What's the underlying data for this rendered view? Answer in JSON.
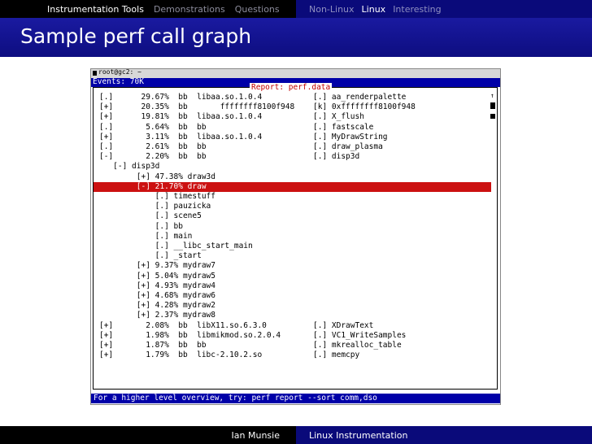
{
  "nav": {
    "left": [
      {
        "label": "Instrumentation Tools",
        "active": true
      },
      {
        "label": "Demonstrations",
        "active": false
      },
      {
        "label": "Questions",
        "active": false
      }
    ],
    "right": [
      {
        "label": "Non-Linux",
        "active": false
      },
      {
        "label": "Linux",
        "active": true
      },
      {
        "label": "Interesting",
        "active": false
      }
    ]
  },
  "slide": {
    "title": "Sample perf call graph"
  },
  "terminal": {
    "window_title": "root@gc2: ~",
    "events": "Events: 70K",
    "report_title": "Report: perf.data",
    "rows": [
      {
        "c1": "[.]      29.67%  bb  libaa.so.1.0.4",
        "c2": "[.] aa_renderpalette",
        "selected": false
      },
      {
        "c1": "[+]      20.35%  bb       ffffffff8100f948",
        "c2": "[k] 0xffffffff8100f948",
        "selected": false
      },
      {
        "c1": "[+]      19.81%  bb  libaa.so.1.0.4",
        "c2": "[.] X_flush",
        "selected": false
      },
      {
        "c1": "[.]       5.64%  bb  bb",
        "c2": "[.] fastscale",
        "selected": false
      },
      {
        "c1": "[+]       3.11%  bb  libaa.so.1.0.4",
        "c2": "[.] MyDrawString",
        "selected": false
      },
      {
        "c1": "[.]       2.61%  bb  bb",
        "c2": "[.] draw_plasma",
        "selected": false
      },
      {
        "c1": "[-]       2.20%  bb  bb",
        "c2": "[.] disp3d",
        "selected": false
      },
      {
        "c1": "   [-] disp3d",
        "c2": "",
        "selected": false
      },
      {
        "c1": "        [+] 47.38% draw3d",
        "c2": "",
        "selected": false
      },
      {
        "c1": "        [-] 21.70% draw",
        "c2": "",
        "selected": true
      },
      {
        "c1": "            [.] timestuff",
        "c2": "",
        "selected": false
      },
      {
        "c1": "            [.] pauzicka",
        "c2": "",
        "selected": false
      },
      {
        "c1": "            [.] scene5",
        "c2": "",
        "selected": false
      },
      {
        "c1": "            [.] bb",
        "c2": "",
        "selected": false
      },
      {
        "c1": "            [.] main",
        "c2": "",
        "selected": false
      },
      {
        "c1": "            [.] __libc_start_main",
        "c2": "",
        "selected": false
      },
      {
        "c1": "            [.] _start",
        "c2": "",
        "selected": false
      },
      {
        "c1": "        [+] 9.37% mydraw7",
        "c2": "",
        "selected": false
      },
      {
        "c1": "        [+] 5.04% mydraw5",
        "c2": "",
        "selected": false
      },
      {
        "c1": "        [+] 4.93% mydraw4",
        "c2": "",
        "selected": false
      },
      {
        "c1": "        [+] 4.68% mydraw6",
        "c2": "",
        "selected": false
      },
      {
        "c1": "        [+] 4.28% mydraw2",
        "c2": "",
        "selected": false
      },
      {
        "c1": "        [+] 2.37% mydraw8",
        "c2": "",
        "selected": false
      },
      {
        "c1": "[+]       2.08%  bb  libX11.so.6.3.0",
        "c2": "[.] XDrawText",
        "selected": false
      },
      {
        "c1": "[+]       1.98%  bb  libmikmod.so.2.0.4",
        "c2": "[.] VC1_WriteSamples",
        "selected": false
      },
      {
        "c1": "[+]       1.87%  bb  bb",
        "c2": "[.] mkrealloc_table",
        "selected": false
      },
      {
        "c1": "[+]       1.79%  bb  libc-2.10.2.so",
        "c2": "[.] memcpy",
        "selected": false
      }
    ],
    "status": "For a higher level overview, try: perf report --sort comm,dso"
  },
  "footer": {
    "author": "Ian Munsie",
    "talk": "Linux Instrumentation"
  }
}
